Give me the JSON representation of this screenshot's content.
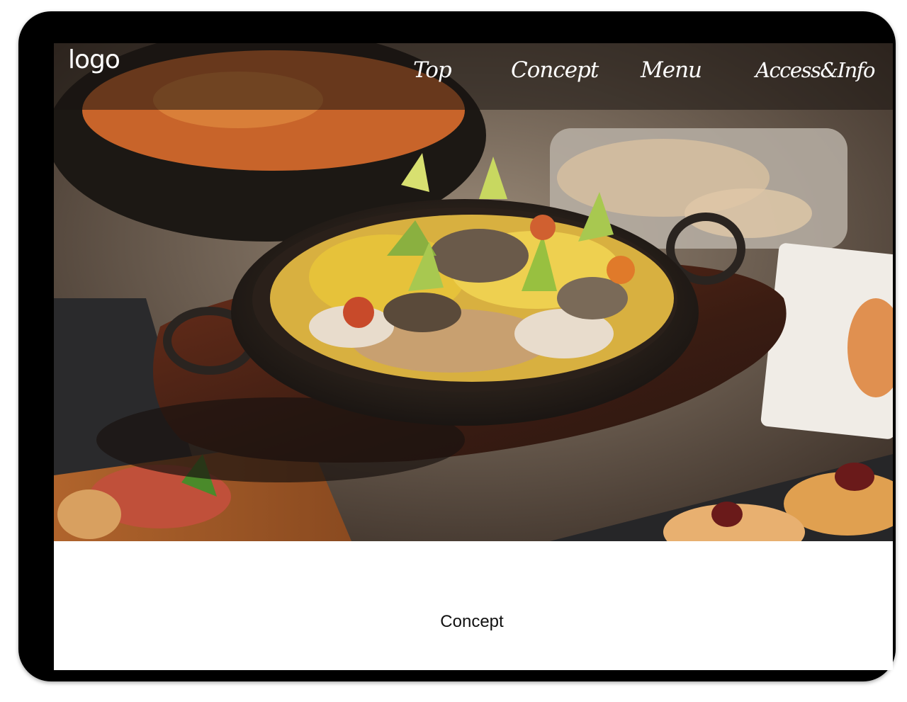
{
  "header": {
    "logo": "logo",
    "nav": [
      {
        "label": "Top"
      },
      {
        "label": "Concept"
      },
      {
        "label": "Menu"
      },
      {
        "label": "Access&Info"
      }
    ]
  },
  "hero": {
    "image_icon": "food-photo"
  },
  "sections": {
    "concept_title": "Concept"
  },
  "colors": {
    "frame": "#000000",
    "navbar_overlay": "rgba(25,20,16,0.55)",
    "nav_text": "#ffffff",
    "page_bg": "#ffffff"
  }
}
